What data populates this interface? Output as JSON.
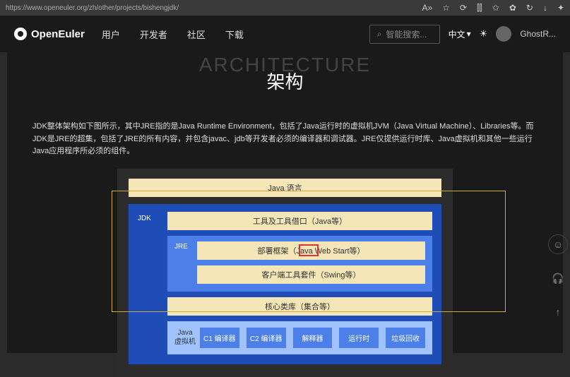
{
  "url": "https://www.openeuler.org/zh/other/projects/bishengjdk/",
  "header": {
    "brand": "OpenEuler",
    "nav": [
      "用户",
      "开发者",
      "社区",
      "下载"
    ],
    "search_placeholder": "智能搜索...",
    "lang": "中文",
    "username": "GhostR..."
  },
  "content": {
    "bg_title": "ARCHITECTURE",
    "fg_title": "架构",
    "description": "JDK整体架构如下图所示，其中JRE指的是Java Runtime Environment，包括了Java运行时的虚拟机JVM（Java Virtual Machine）、Libraries等。而JDK是JRE的超集，包括了JRE的所有内容，并包含javac、jdb等开发者必须的编译器和调试器。JRE仅提供运行时库、Java虚拟机和其他一些运行Java应用程序所必须的组件。"
  },
  "diagram": {
    "java_lang": "Java 语言",
    "jdk_label": "JDK",
    "tools": "工具及工具借口（Java等）",
    "jre_label": "JRE",
    "deploy": "部署框架（Java Web Start等）",
    "client": "客户端工具套件（Swing等）",
    "core": "核心类库（集合等）",
    "jvm_label": "Java\n虚拟机",
    "jvm_items": [
      "C1 编译器",
      "C2 编译器",
      "解释器",
      "运行时",
      "垃圾回收"
    ]
  }
}
